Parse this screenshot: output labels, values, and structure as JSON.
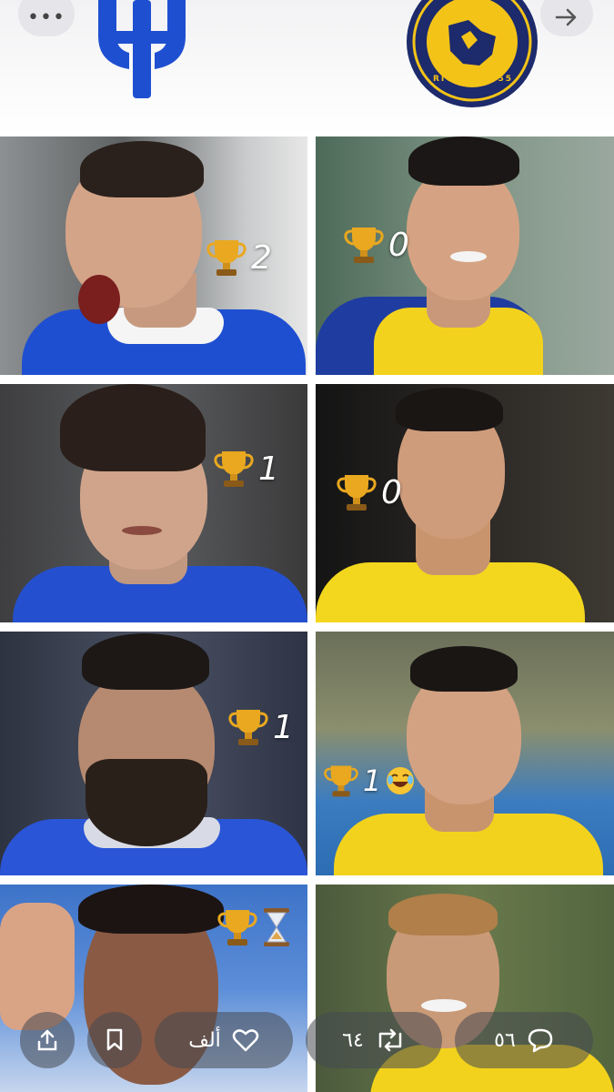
{
  "header": {
    "more_icon": "more-horizontal-icon",
    "forward_icon": "arrow-right-icon",
    "left_club": "al-hilal-logo",
    "right_club": "al-nassr-logo",
    "right_logo_text": "RIYADH 1955"
  },
  "colors": {
    "hilal_blue": "#1f4fd1",
    "nassr_yellow": "#f3d21d",
    "nassr_navy": "#1d2a6b"
  },
  "grid": {
    "left_column": [
      {
        "trophy_count": "2",
        "extra": ""
      },
      {
        "trophy_count": "1",
        "extra": ""
      },
      {
        "trophy_count": "1",
        "extra": ""
      },
      {
        "trophy_count": "",
        "extra": "hourglass"
      }
    ],
    "right_column": [
      {
        "trophy_count": "0",
        "extra": ""
      },
      {
        "trophy_count": "0",
        "extra": ""
      },
      {
        "trophy_count": "1",
        "extra": "laughing-emoji"
      },
      {
        "trophy_count": "",
        "extra": ""
      }
    ]
  },
  "actions": {
    "share_icon": "share-icon",
    "bookmark_icon": "bookmark-icon",
    "likes_count": "ألف",
    "retweets_count": "٦٤",
    "replies_count": "٥٦"
  }
}
